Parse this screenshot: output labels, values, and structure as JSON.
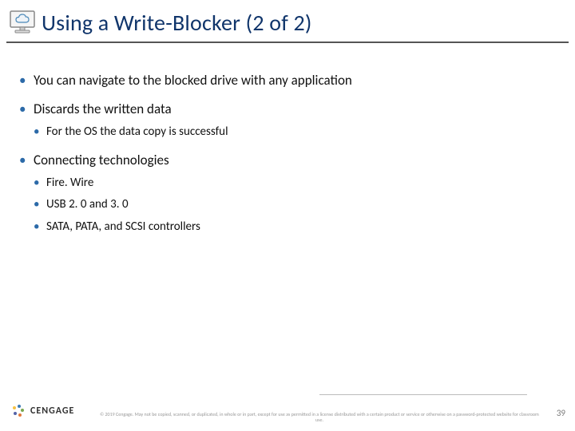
{
  "title": "Using a Write-Blocker (2 of 2)",
  "bullets": [
    {
      "text": "You can navigate to the blocked drive with any application"
    },
    {
      "text": "Discards the written data",
      "sub": [
        {
          "text": "For the OS the data copy is successful"
        }
      ]
    },
    {
      "text": "Connecting technologies",
      "sub": [
        {
          "text": "Fire. Wire"
        },
        {
          "text": "USB 2. 0 and 3. 0"
        },
        {
          "text": "SATA, PATA, and SCSI controllers"
        }
      ]
    }
  ],
  "brand": {
    "name": "CENGAGE"
  },
  "copyright": "© 2019 Cengage. May not be copied, scanned, or duplicated, in whole or in part, except for use as permitted in a license distributed with a certain product or service or otherwise on a password-protected website for classroom use.",
  "page_number": "39"
}
